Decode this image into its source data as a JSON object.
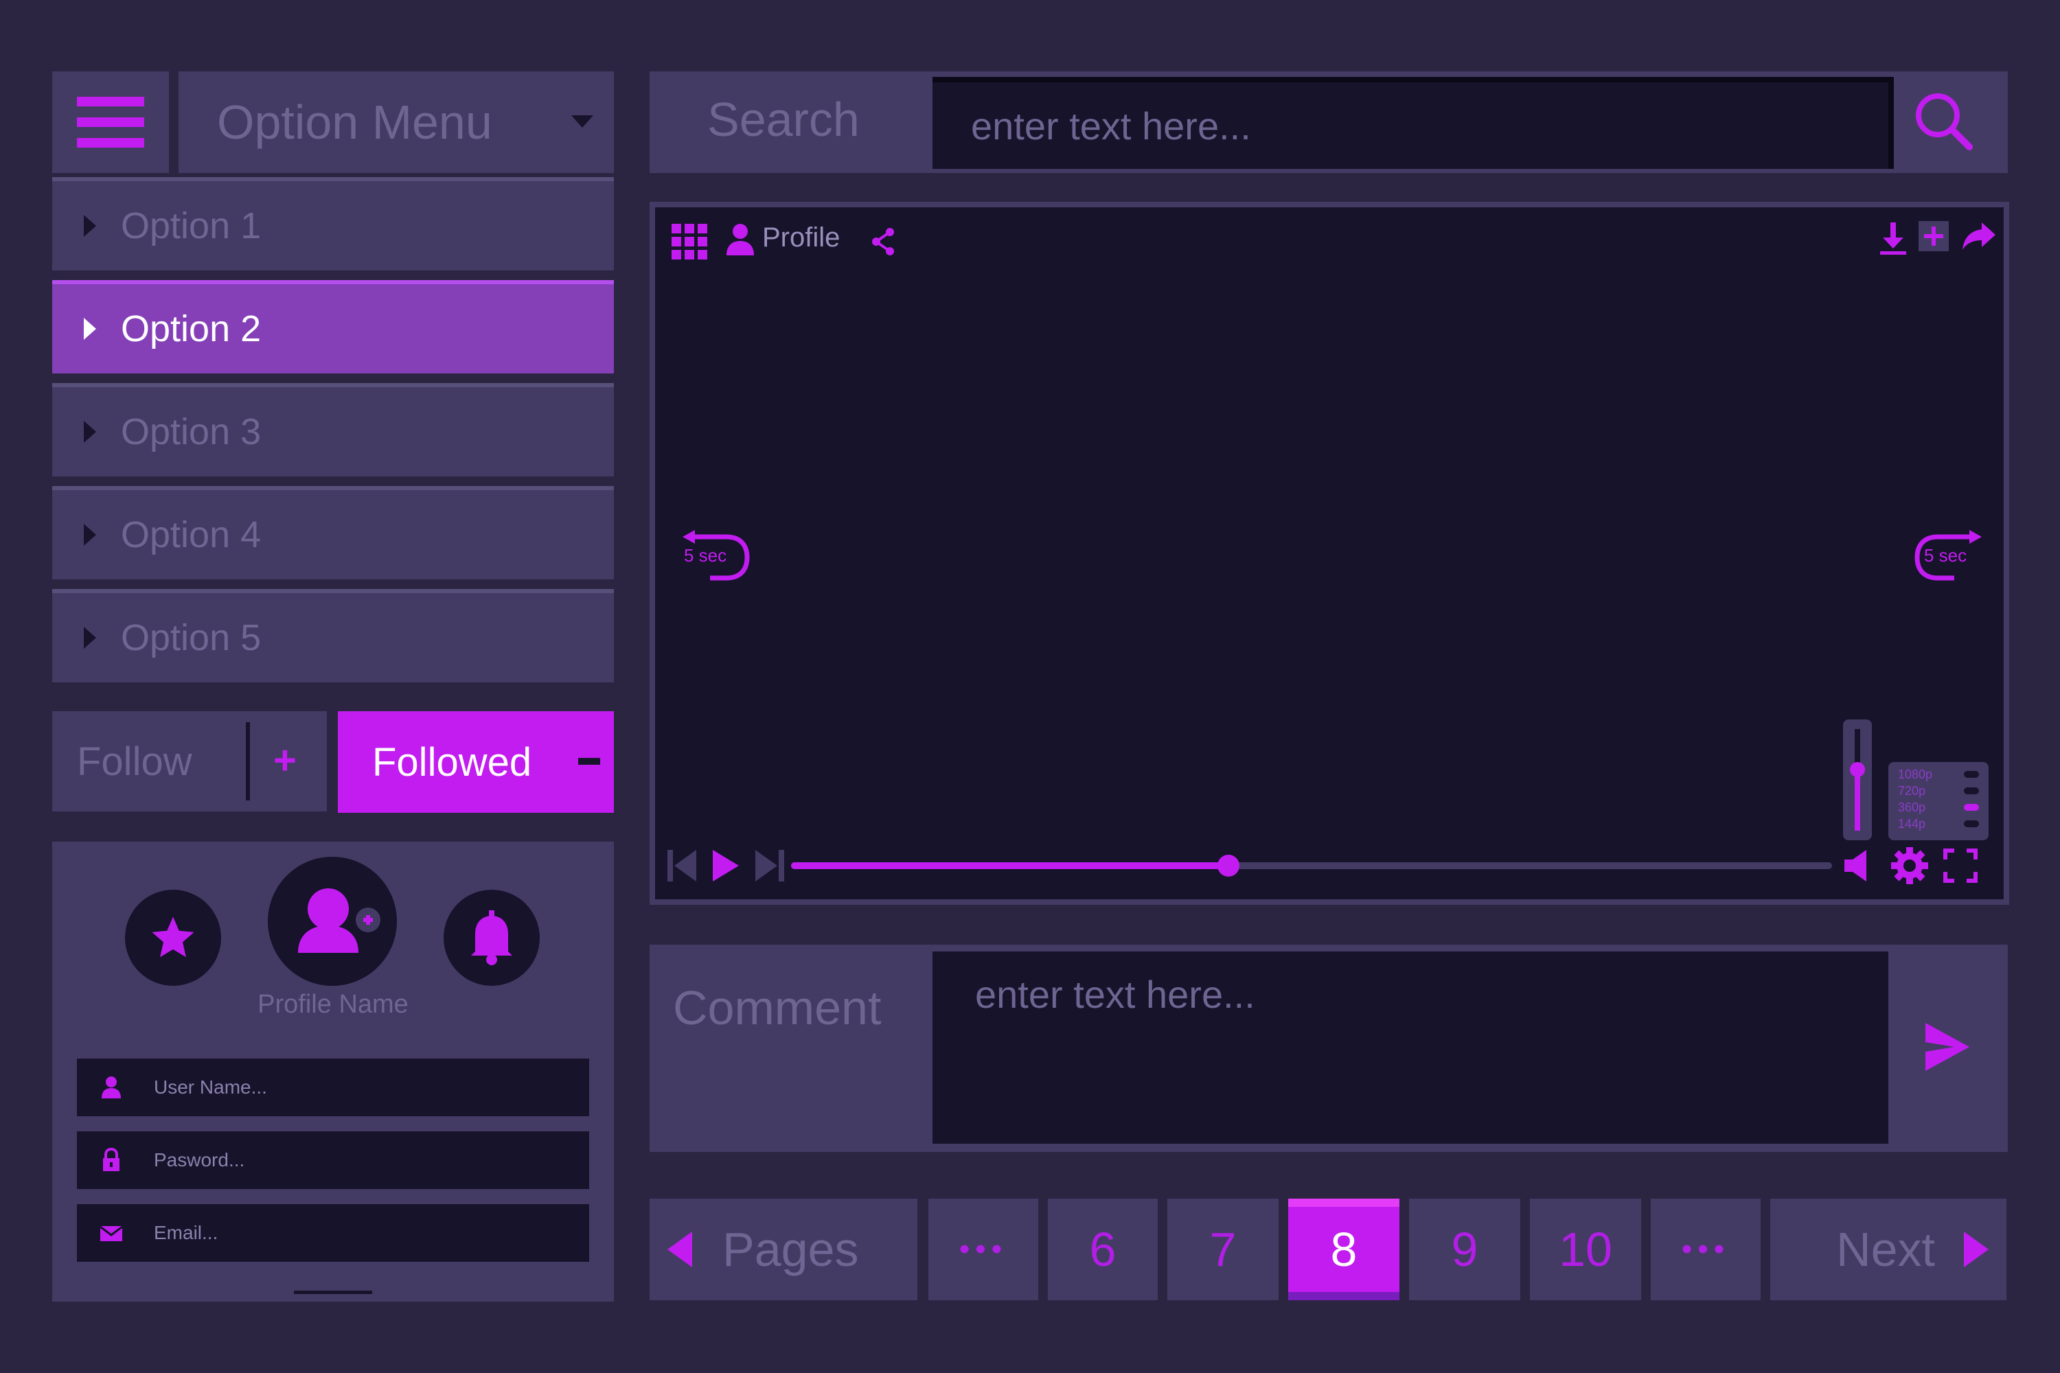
{
  "colors": {
    "background": "#2b2541",
    "panel": "#443b64",
    "dark": "#16132b",
    "accent": "#c21cf0",
    "active_option": "#8540b8"
  },
  "menu": {
    "title": "Option Menu",
    "options": [
      {
        "label": "Option 1",
        "active": false
      },
      {
        "label": "Option 2",
        "active": true
      },
      {
        "label": "Option 3",
        "active": false
      },
      {
        "label": "Option 4",
        "active": false
      },
      {
        "label": "Option 5",
        "active": false
      }
    ],
    "icons": {
      "hamburger": "hamburger-icon",
      "dropdown": "caret-down-icon"
    }
  },
  "follow": {
    "follow_label": "Follow",
    "follow_symbol": "+",
    "followed_label": "Followed",
    "followed_symbol": "−"
  },
  "profile": {
    "name": "Profile Name",
    "fields": {
      "username": "User Name...",
      "password": "Pasword...",
      "email": "Email..."
    },
    "icons": [
      "star-icon",
      "add-user-icon",
      "bell-icon",
      "user-icon",
      "lock-icon",
      "mail-icon"
    ]
  },
  "search": {
    "label": "Search",
    "placeholder": "enter text here...",
    "icon": "search-icon"
  },
  "player": {
    "profile_label": "Profile",
    "rewind_label": "5 sec",
    "forward_label": "5 sec",
    "progress": 0.42,
    "volume": 0.6,
    "quality_options": [
      "1080p",
      "720p",
      "360p",
      "144p"
    ],
    "selected_quality": "360p",
    "icons": [
      "grid-icon",
      "user-icon",
      "share-icon",
      "download-icon",
      "add-icon",
      "forward-share-icon",
      "skip-back-icon",
      "play-icon",
      "skip-forward-icon",
      "volume-icon",
      "settings-icon",
      "fullscreen-icon"
    ]
  },
  "comment": {
    "label": "Comment",
    "placeholder": "enter text here...",
    "icon": "send-icon"
  },
  "pagination": {
    "prev_label": "Pages",
    "ellipsis": "•••",
    "pages": [
      "6",
      "7",
      "8",
      "9",
      "10"
    ],
    "current": "8",
    "next_label": "Next"
  }
}
